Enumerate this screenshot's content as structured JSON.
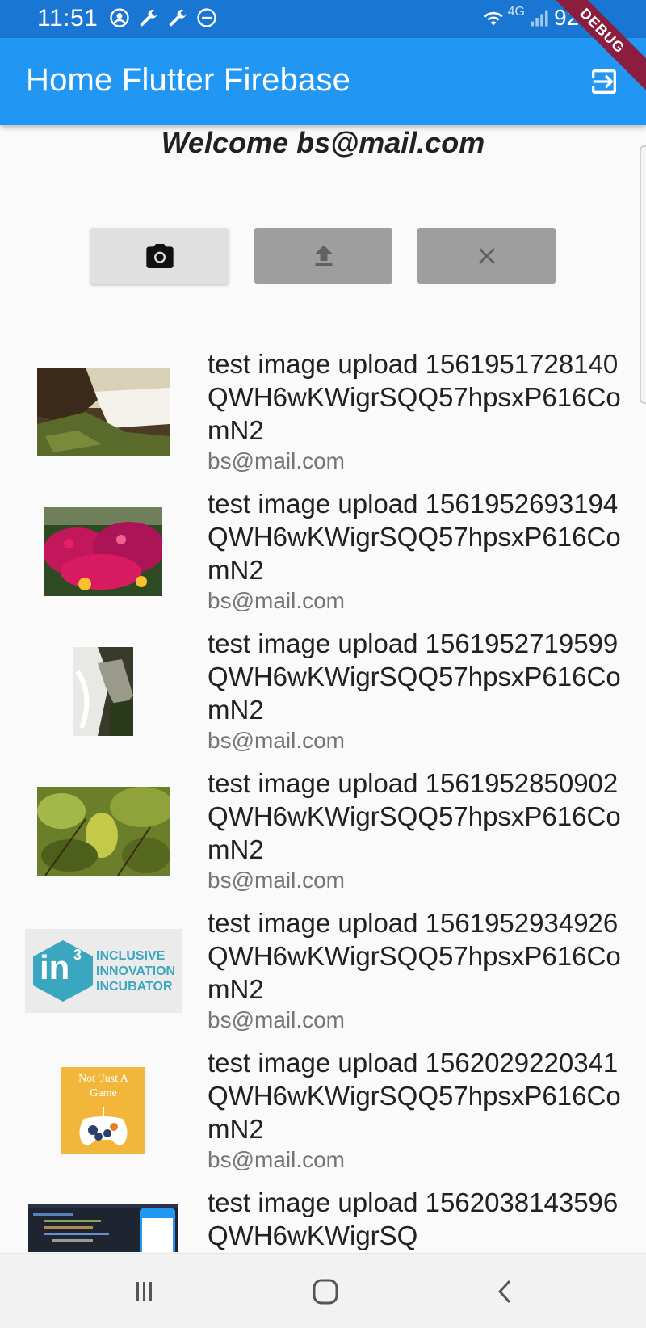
{
  "status_bar": {
    "time": "11:51",
    "network": "4G",
    "battery": "92%",
    "left_icons": [
      "account-circle-icon",
      "wrench-icon",
      "wrench-icon",
      "do-not-disturb-icon"
    ]
  },
  "app_bar": {
    "title": "Home Flutter Firebase",
    "debug_label": "DEBUG"
  },
  "welcome": "Welcome bs@mail.com",
  "buttons": {
    "camera": "camera-icon",
    "upload": "upload-icon",
    "clear": "close-icon"
  },
  "items": [
    {
      "title": "test image upload 1561951728140QWH6wKWigrSQQ57hpsxP616ComN2",
      "email": "bs@mail.com",
      "thumb": "waterfall"
    },
    {
      "title": "test image upload 1561952693194QWH6wKWigrSQQ57hpsxP616ComN2",
      "email": "bs@mail.com",
      "thumb": "flowers"
    },
    {
      "title": "test image upload 1561952719599QWH6wKWigrSQQ57hpsxP616ComN2",
      "email": "bs@mail.com",
      "thumb": "stream"
    },
    {
      "title": "test image upload 1561952850902QWH6wKWigrSQQ57hpsxP616ComN2",
      "email": "bs@mail.com",
      "thumb": "leaves"
    },
    {
      "title": "test image upload 1561952934926QWH6wKWigrSQQ57hpsxP616ComN2",
      "email": "bs@mail.com",
      "thumb": "incubator-logo",
      "logo_text": [
        "INCLUSIVE",
        "INNOVATION",
        "INCUBATOR"
      ],
      "logo_mark": "in",
      "logo_sup": "3"
    },
    {
      "title": "test image upload 1562029220341QWH6wKWigrSQQ57hpsxP616ComN2",
      "email": "bs@mail.com",
      "thumb": "game-logo",
      "logo_text": "Not 'Just A Game"
    },
    {
      "title": "test image upload 1562038143596QWH6wKWigrSQ",
      "email": "",
      "thumb": "code-screenshot"
    }
  ],
  "colors": {
    "status_bar": "#1976d2",
    "app_bar": "#2196f3",
    "background": "#fafafa",
    "debug_banner": "#8b1e3f"
  }
}
